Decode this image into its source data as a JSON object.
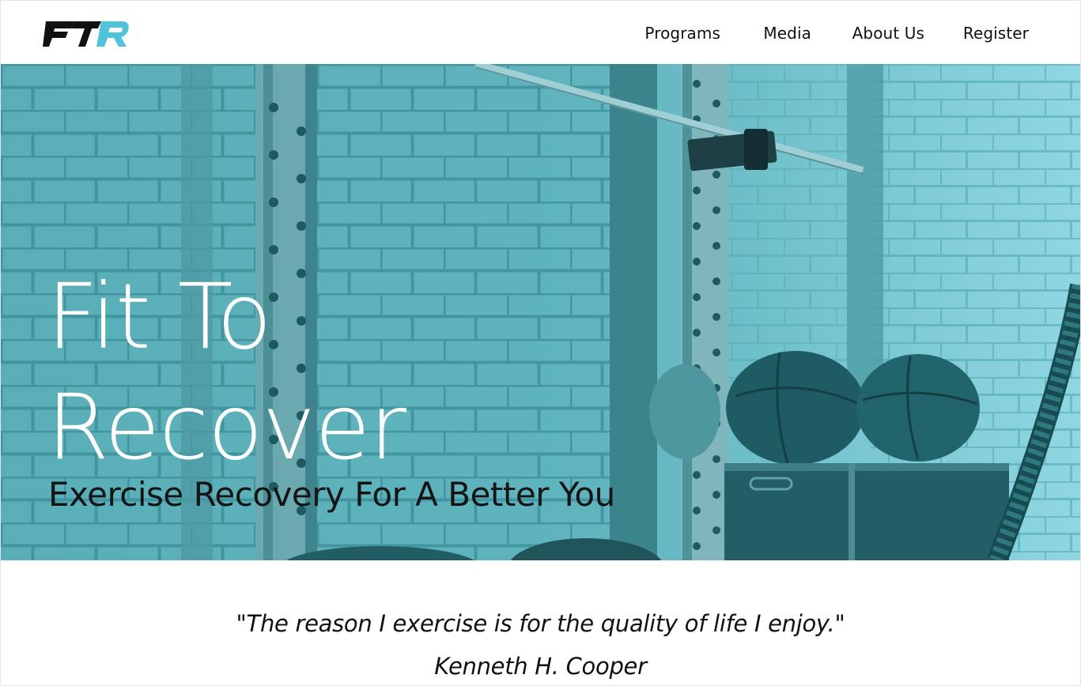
{
  "brand": {
    "logo_text": "FTR",
    "colors": {
      "dark": "#111111",
      "accent": "#4fc3d9"
    }
  },
  "nav": {
    "items": [
      {
        "label": "Programs"
      },
      {
        "label": "Media"
      },
      {
        "label": "About Us"
      },
      {
        "label": "Register"
      }
    ]
  },
  "hero": {
    "title_line1": "Fit To",
    "title_line2": "Recover",
    "subtitle": "Exercise Recovery For A Better You",
    "overlay_color": "#5fb8c2"
  },
  "quote": {
    "text": "\"The reason I exercise is for the quality of life I enjoy.\"",
    "author": "Kenneth H. Cooper"
  }
}
